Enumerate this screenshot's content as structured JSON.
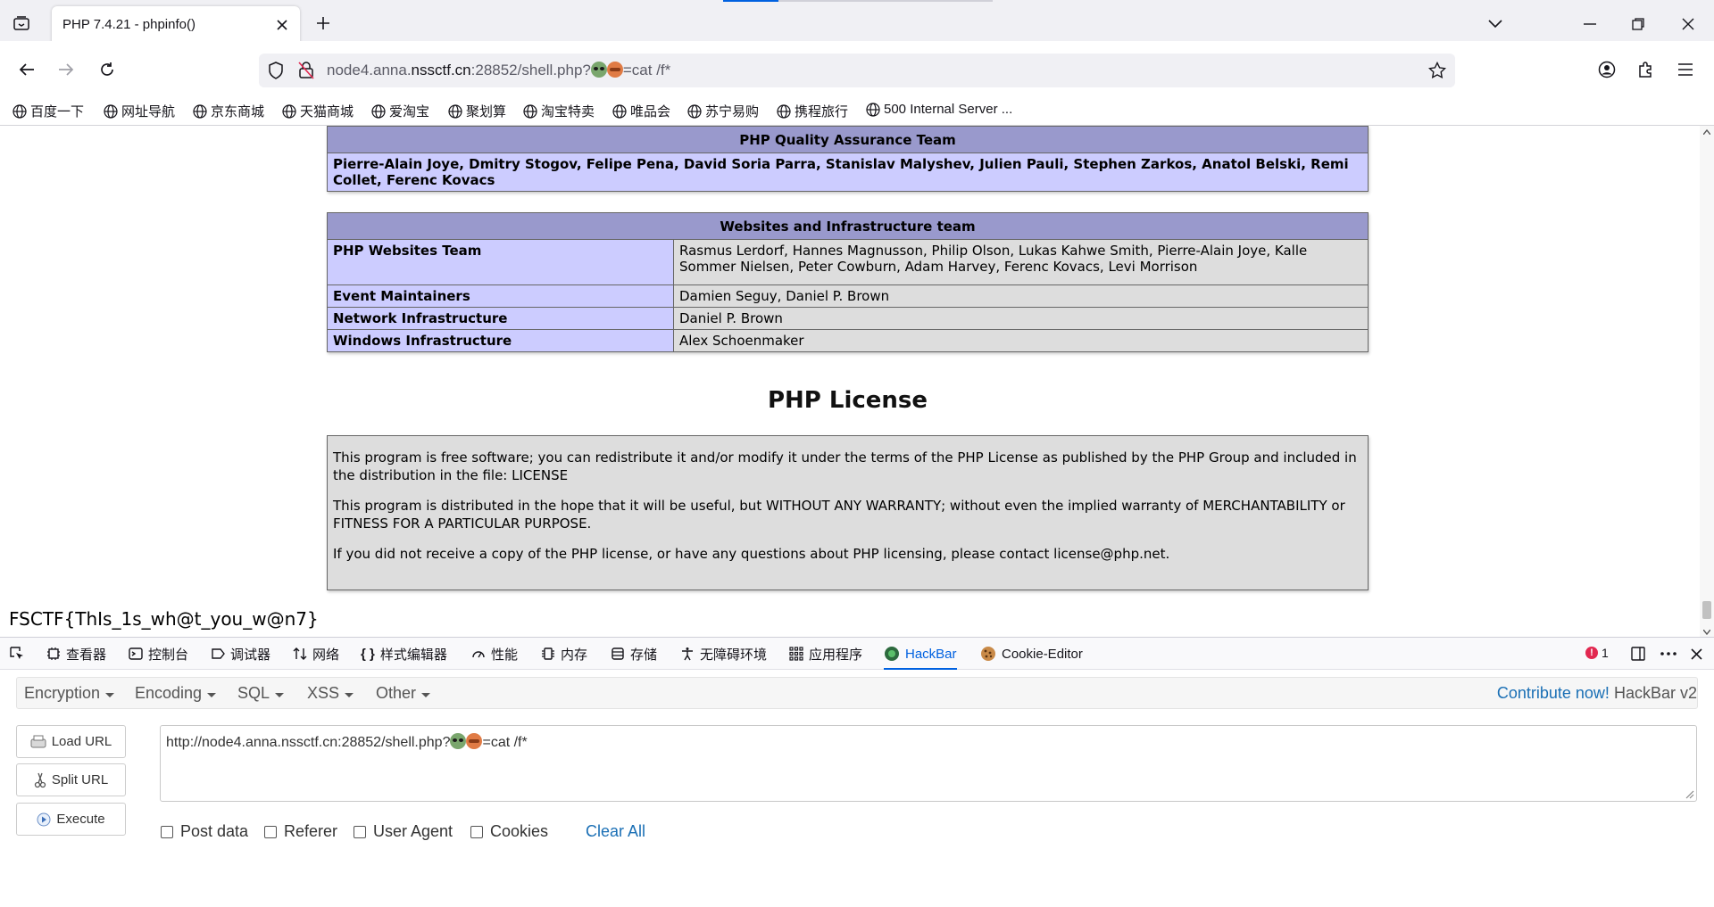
{
  "browser": {
    "tab_title": "PHP 7.4.21 - phpinfo()",
    "url_prefix": "node4.anna.",
    "url_domain": "nssctf.cn",
    "url_port_path": ":28852/shell.php?",
    "url_query": "=cat /f*",
    "bookmarks": [
      "百度一下",
      "网址导航",
      "京东商城",
      "天猫商城",
      "爱淘宝",
      "聚划算",
      "淘宝特卖",
      "唯品会",
      "苏宁易购",
      "携程旅行",
      "500 Internal Server ..."
    ]
  },
  "phpinfo": {
    "qa_team_header": "PHP Quality Assurance Team",
    "qa_team_members": "Pierre-Alain Joye, Dmitry Stogov, Felipe Pena, David Soria Parra, Stanislav Malyshev, Julien Pauli, Stephen Zarkos, Anatol Belski, Remi Collet, Ferenc Kovacs",
    "infra_header": "Websites and Infrastructure team",
    "infra_rows": [
      {
        "label": "PHP Websites Team",
        "value": "Rasmus Lerdorf, Hannes Magnusson, Philip Olson, Lukas Kahwe Smith, Pierre-Alain Joye, Kalle Sommer Nielsen, Peter Cowburn, Adam Harvey, Ferenc Kovacs, Levi Morrison"
      },
      {
        "label": "Event Maintainers",
        "value": "Damien Seguy, Daniel P. Brown"
      },
      {
        "label": "Network Infrastructure",
        "value": "Daniel P. Brown"
      },
      {
        "label": "Windows Infrastructure",
        "value": "Alex Schoenmaker"
      }
    ],
    "license_title": "PHP License",
    "license_paragraphs": [
      "This program is free software; you can redistribute it and/or modify it under the terms of the PHP License as published by the PHP Group and included in the distribution in the file: LICENSE",
      "This program is distributed in the hope that it will be useful, but WITHOUT ANY WARRANTY; without even the implied warranty of MERCHANTABILITY or FITNESS FOR A PARTICULAR PURPOSE.",
      "If you did not receive a copy of the PHP license, or have any questions about PHP licensing, please contact license@php.net."
    ]
  },
  "flag_output": "FSCTF{ThIs_1s_wh@t_you_w@n7}",
  "devtools": {
    "tabs": [
      "查看器",
      "控制台",
      "调试器",
      "网络",
      "样式编辑器",
      "性能",
      "内存",
      "存储",
      "无障碍环境",
      "应用程序",
      "HackBar",
      "Cookie-Editor"
    ],
    "active_tab": "HackBar",
    "error_count": "1"
  },
  "hackbar": {
    "menus": [
      "Encryption",
      "Encoding",
      "SQL",
      "XSS",
      "Other"
    ],
    "contribute_link": "Contribute now!",
    "version": "HackBar v2",
    "load_url": "Load URL",
    "split_url": "Split URL",
    "execute": "Execute",
    "url_prefix": "http://node4.anna.nssctf.cn:28852/shell.php?",
    "url_query": "=cat /f*",
    "checks": [
      "Post data",
      "Referer",
      "User Agent",
      "Cookies"
    ],
    "clear_all": "Clear All"
  },
  "colors": {
    "accent": "#0061e0",
    "php_header": "#9999cc",
    "php_label": "#ccccff",
    "php_value": "#dddddd"
  }
}
